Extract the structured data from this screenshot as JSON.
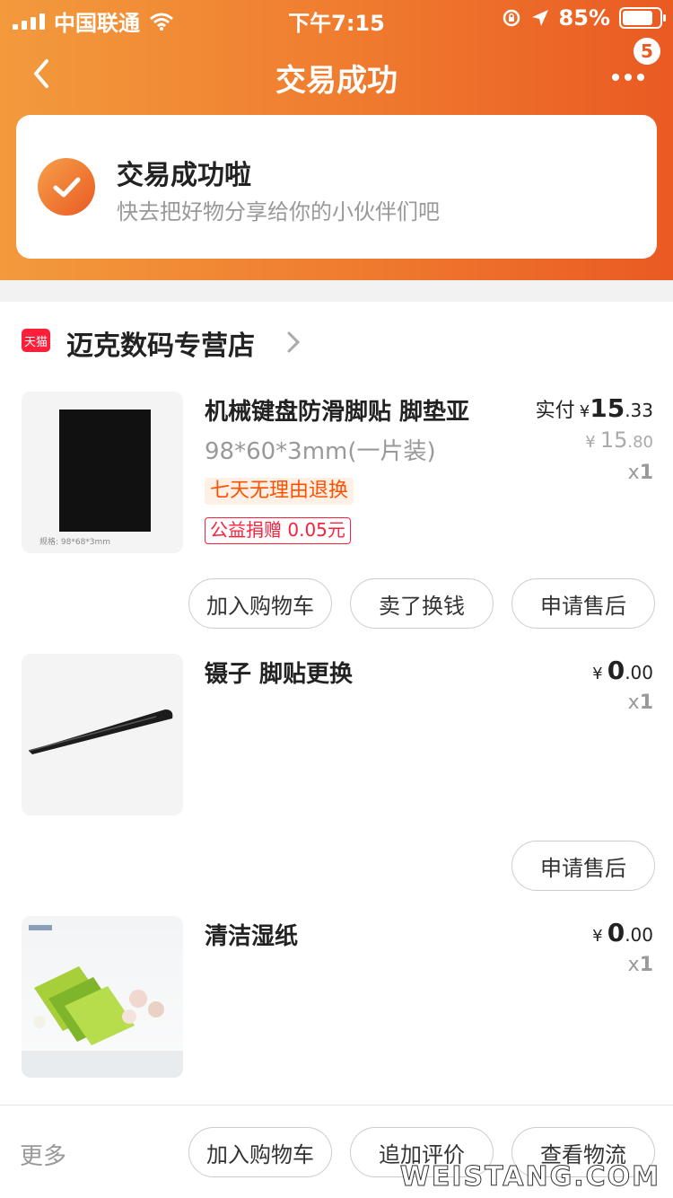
{
  "status_bar": {
    "carrier": "中国联通",
    "time": "下午7:15",
    "battery_percent": "85%",
    "battery_level": 0.85
  },
  "nav": {
    "title": "交易成功",
    "badge_count": "5"
  },
  "success": {
    "title": "交易成功啦",
    "subtitle": "快去把好物分享给你的小伙伴们吧"
  },
  "shop": {
    "badge": "天猫",
    "name": "迈克数码专营店"
  },
  "items": [
    {
      "title": "机械键盘防滑脚贴 脚垫亚",
      "spec": "98*60*3mm(一片装)",
      "tags": [
        "七天无理由退换",
        "公益捐赠 0.05元"
      ],
      "paid_label": "实付",
      "currency": "¥",
      "price_int": "15",
      "price_dec": ".33",
      "orig_int": "15",
      "orig_dec": ".80",
      "qty_prefix": "x",
      "qty": "1",
      "image_caption": "规格: 98*68*3mm",
      "buttons": [
        "加入购物车",
        "卖了换钱",
        "申请售后"
      ]
    },
    {
      "title": "镊子 脚贴更换",
      "currency": "¥",
      "price_int": "0",
      "price_dec": ".00",
      "qty_prefix": "x",
      "qty": "1",
      "buttons": [
        "申请售后"
      ]
    },
    {
      "title": "清洁湿纸",
      "currency": "¥",
      "price_int": "0",
      "price_dec": ".00",
      "qty_prefix": "x",
      "qty": "1"
    }
  ],
  "bottom_bar": {
    "more": "更多",
    "buttons": [
      "加入购物车",
      "追加评价",
      "查看物流"
    ]
  },
  "watermark": "WEISTANG.COM",
  "colors": {
    "accent": "#ea5a23",
    "accent_light": "#f39a3d",
    "tmall_red": "#ff1f3a",
    "promo_orange": "#ff5000"
  }
}
